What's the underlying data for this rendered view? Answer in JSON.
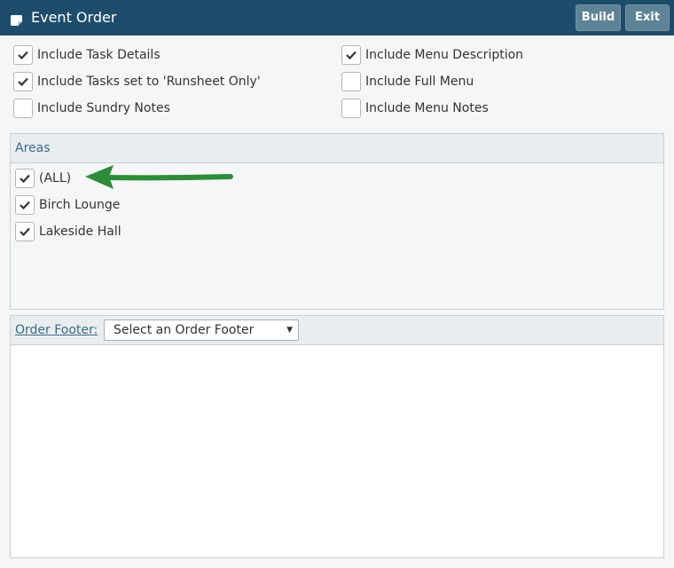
{
  "header": {
    "title": "Event Order",
    "build_label": "Build",
    "exit_label": "Exit"
  },
  "options": {
    "left": [
      {
        "label": "Include Task Details",
        "checked": true
      },
      {
        "label": "Include Tasks set to 'Runsheet Only'",
        "checked": true
      },
      {
        "label": "Include Sundry Notes",
        "checked": false
      }
    ],
    "right": [
      {
        "label": "Include Menu Description",
        "checked": true
      },
      {
        "label": "Include Full Menu",
        "checked": false
      },
      {
        "label": "Include Menu Notes",
        "checked": false
      }
    ]
  },
  "areas": {
    "title": "Areas",
    "items": [
      {
        "label": "(ALL)",
        "checked": true
      },
      {
        "label": "Birch Lounge",
        "checked": true
      },
      {
        "label": "Lakeside Hall",
        "checked": true
      }
    ]
  },
  "order_footer": {
    "label": "Order Footer:",
    "select_value": "Select an Order Footer"
  },
  "colors": {
    "header_bg": "#1e4d6b",
    "button_bg": "#5e8397",
    "arrow": "#2e8b3a",
    "link": "#3c6b86"
  },
  "icons": {
    "title": "note-icon",
    "checkbox": "checkmark-icon",
    "select": "caret-down-icon",
    "annotation": "arrow-left-icon"
  }
}
